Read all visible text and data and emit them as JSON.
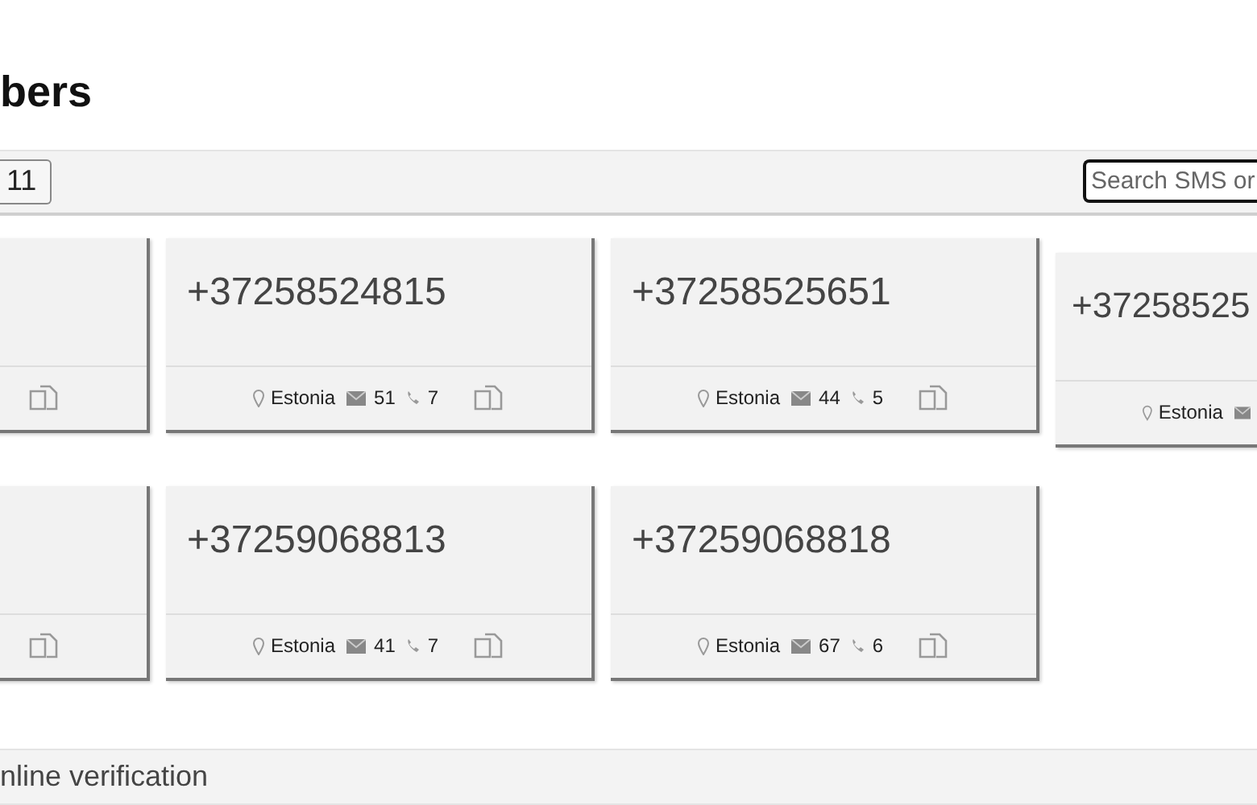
{
  "heading": "bers",
  "toolbar": {
    "page_button": "11",
    "search": {
      "placeholder": "Search SMS or"
    }
  },
  "rows": [
    {
      "cards": [
        {
          "kind": "stub"
        },
        {
          "kind": "full",
          "number": "+37258524815",
          "country": "Estonia",
          "sms": "51",
          "calls": "7"
        },
        {
          "kind": "full",
          "number": "+37258525651",
          "country": "Estonia",
          "sms": "44",
          "calls": "5"
        },
        {
          "kind": "edge",
          "number": "+37258525",
          "country": "Estonia"
        }
      ]
    },
    {
      "cards": [
        {
          "kind": "stub"
        },
        {
          "kind": "full",
          "number": "+37259068813",
          "country": "Estonia",
          "sms": "41",
          "calls": "7"
        },
        {
          "kind": "full",
          "number": "+37259068818",
          "country": "Estonia",
          "sms": "67",
          "calls": "6"
        }
      ]
    }
  ],
  "footer_band": "nline verification"
}
